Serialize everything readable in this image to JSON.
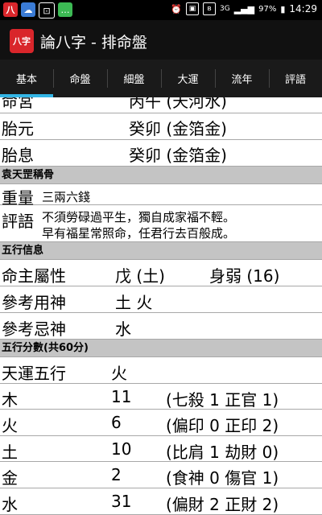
{
  "status_bar": {
    "battery": "97%",
    "time": "14:29",
    "network": "3G"
  },
  "app": {
    "logo_text": "八字",
    "title": "論八字 - 排命盤"
  },
  "tabs": [
    "基本",
    "命盤",
    "細盤",
    "大運",
    "流年",
    "評語"
  ],
  "basic": {
    "partial": {
      "label": "命宮",
      "value": "丙午 (天河水)"
    },
    "taiyuan": {
      "label": "胎元",
      "value": "癸卯 (金箔金)"
    },
    "taixi": {
      "label": "胎息",
      "value": "癸卯 (金箔金)"
    }
  },
  "bone_weight": {
    "header": "袁天罡稱骨",
    "weight_label": "重量",
    "weight_value": "三兩六錢",
    "comment_label": "評語",
    "comment_line1": "不須勞碌過平生，獨自成家福不輕。",
    "comment_line2": "早有福星常照命，任君行去百般成。"
  },
  "five_elements_info": {
    "header": "五行信息",
    "rows": [
      {
        "label": "命主屬性",
        "value": "戊 (土)",
        "extra": "身弱 (16)"
      },
      {
        "label": "參考用神",
        "value": "土 火"
      },
      {
        "label": "參考忌神",
        "value": "水"
      }
    ]
  },
  "five_elements_score": {
    "header": "五行分數(共60分)",
    "tianyun": {
      "label": "天運五行",
      "value": "火"
    },
    "rows": [
      {
        "label": "木",
        "value": "11",
        "detail": "(七殺 1 正官 1)"
      },
      {
        "label": "火",
        "value": "6",
        "detail": "(偏印 0 正印 2)"
      },
      {
        "label": "土",
        "value": "10",
        "detail": "(比肩 1 劫財 0)"
      },
      {
        "label": "金",
        "value": "2",
        "detail": "(食神 0 傷官 1)"
      },
      {
        "label": "水",
        "value": "31",
        "detail": "(偏財 2 正財 2)"
      }
    ]
  }
}
